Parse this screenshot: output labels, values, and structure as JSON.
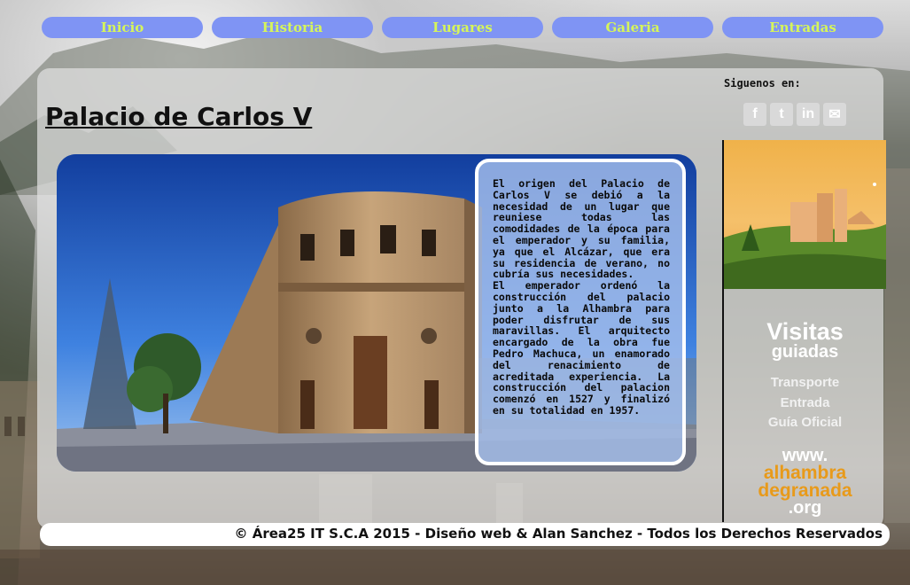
{
  "nav": {
    "items": [
      {
        "label": "Inicio"
      },
      {
        "label": "Historia"
      },
      {
        "label": "Lugares"
      },
      {
        "label": "Galeria"
      },
      {
        "label": "Entradas"
      }
    ]
  },
  "main": {
    "title": "Palacio de Carlos V",
    "paragraphs": [
      "El origen del Palacio de Carlos V se debió a la necesidad de un lugar que reuniese todas las comodidades de la época para el emperador y su familia, ya que el Alcázar, que era su residencia de verano, no cubría sus necesidades.",
      "El emperador ordenó la construcción del palacio junto a la Alhambra para poder disfrutar de sus maravillas. El arquitecto encargado de la obra fue Pedro Machuca, un enamorado del renacimiento de acreditada experiencia. La construcción del palacion comenzó en 1527 y finalizó en su totalidad en 1957."
    ]
  },
  "sidebar": {
    "follow_label": "Siguenos en:",
    "social": [
      {
        "icon": "facebook-icon",
        "glyph": "f"
      },
      {
        "icon": "twitter-icon",
        "glyph": "t"
      },
      {
        "icon": "linkedin-icon",
        "glyph": "in"
      },
      {
        "icon": "mail-icon",
        "glyph": "✉"
      }
    ],
    "banner": {
      "title": "Visitas",
      "subtitle": "guiadas",
      "items": [
        "Transporte",
        "Entrada",
        "Guía Oficial"
      ],
      "url_lines": [
        "www.",
        "alhambra",
        "degranada",
        ".org"
      ]
    }
  },
  "footer": {
    "text": "© Área25 IT S.C.A 2015 - Diseño web & Alan Sanchez - Todos los Derechos Reservados"
  },
  "colors": {
    "nav_bg": "#7f94f4",
    "nav_text": "#d6f55a",
    "url_accent": "#e89a1a"
  }
}
